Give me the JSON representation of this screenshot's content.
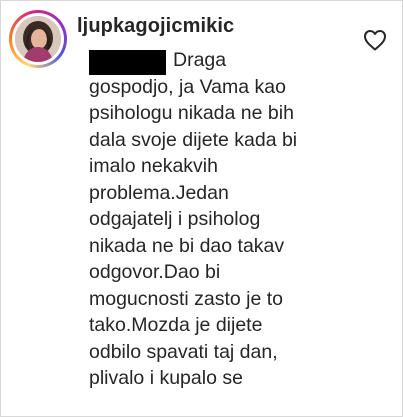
{
  "comment": {
    "username": "ljupkagojicmikic",
    "lines": [
      "Draga",
      "gospodjo, ja Vama kao",
      "psihologu nikada ne bih",
      "dala svoje dijete kada bi",
      "imalo nekakvih",
      "problema.Jedan",
      "odgajatelj i psiholog",
      "nikada ne bi dao takav",
      "odgovor.Dao bi",
      "mogucnosti zasto je to",
      "tako.Mozda je dijete",
      "odbilo spavati taj dan,",
      "plivalo i kupalo se"
    ]
  },
  "icons": {
    "like": "heart-outline-icon",
    "avatar_ring": "story-ring"
  },
  "colors": {
    "text": "#262626",
    "redaction": "#000000",
    "border": "#d9d9d9"
  }
}
